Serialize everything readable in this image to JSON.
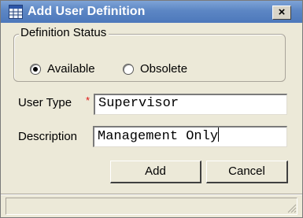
{
  "window": {
    "title": "Add User Definition",
    "close_glyph": "×",
    "icon": "form-grid-icon"
  },
  "definition_status": {
    "legend": "Definition Status",
    "options": [
      {
        "label": "Available",
        "selected": true
      },
      {
        "label": "Obsolete",
        "selected": false
      }
    ]
  },
  "user_type": {
    "label": "User Type",
    "required_marker": "*",
    "value": "Supervisor"
  },
  "description": {
    "label": "Description",
    "value": "Management Only"
  },
  "buttons": {
    "add_label": "Add",
    "cancel_label": "Cancel"
  },
  "colors": {
    "titlebar": "#5c86c4",
    "dialog_bg": "#ece9d8",
    "required_marker": "#dd1111"
  }
}
